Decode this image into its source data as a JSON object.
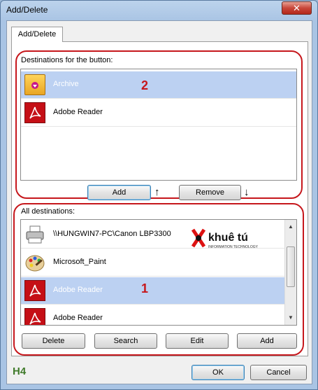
{
  "window": {
    "title": "Add/Delete",
    "close_label": "✕"
  },
  "tab": {
    "label": "Add/Delete"
  },
  "button_destinations": {
    "label": "Destinations for the button:",
    "items": [
      {
        "label": "Archive",
        "icon": "archive-folder-icon",
        "selected": true
      },
      {
        "label": "Adobe Reader",
        "icon": "adobe-reader-icon",
        "selected": false
      }
    ],
    "add_label": "Add",
    "remove_label": "Remove",
    "add_arrow": "↑",
    "remove_arrow": "↓",
    "marker": "2"
  },
  "all_destinations": {
    "label": "All destinations:",
    "items": [
      {
        "label": "\\\\HUNGWIN7-PC\\Canon LBP3300",
        "icon": "printer-icon",
        "selected": false
      },
      {
        "label": "Microsoft_Paint",
        "icon": "paint-palette-icon",
        "selected": false
      },
      {
        "label": "Adobe Reader",
        "icon": "adobe-reader-icon",
        "selected": true
      },
      {
        "label": "Adobe Reader",
        "icon": "adobe-reader-icon",
        "selected": false
      }
    ],
    "delete_label": "Delete",
    "search_label": "Search",
    "edit_label": "Edit",
    "add_label": "Add",
    "marker": "1"
  },
  "watermark": {
    "brand": "khuê tú",
    "tagline": "INFORMATION TECHNOLOGY"
  },
  "footer": {
    "tag": "H4",
    "ok_label": "OK",
    "cancel_label": "Cancel"
  },
  "colors": {
    "highlight": "#c6171c",
    "selection": "#bcd1f2",
    "adobe": "#c50f16"
  }
}
